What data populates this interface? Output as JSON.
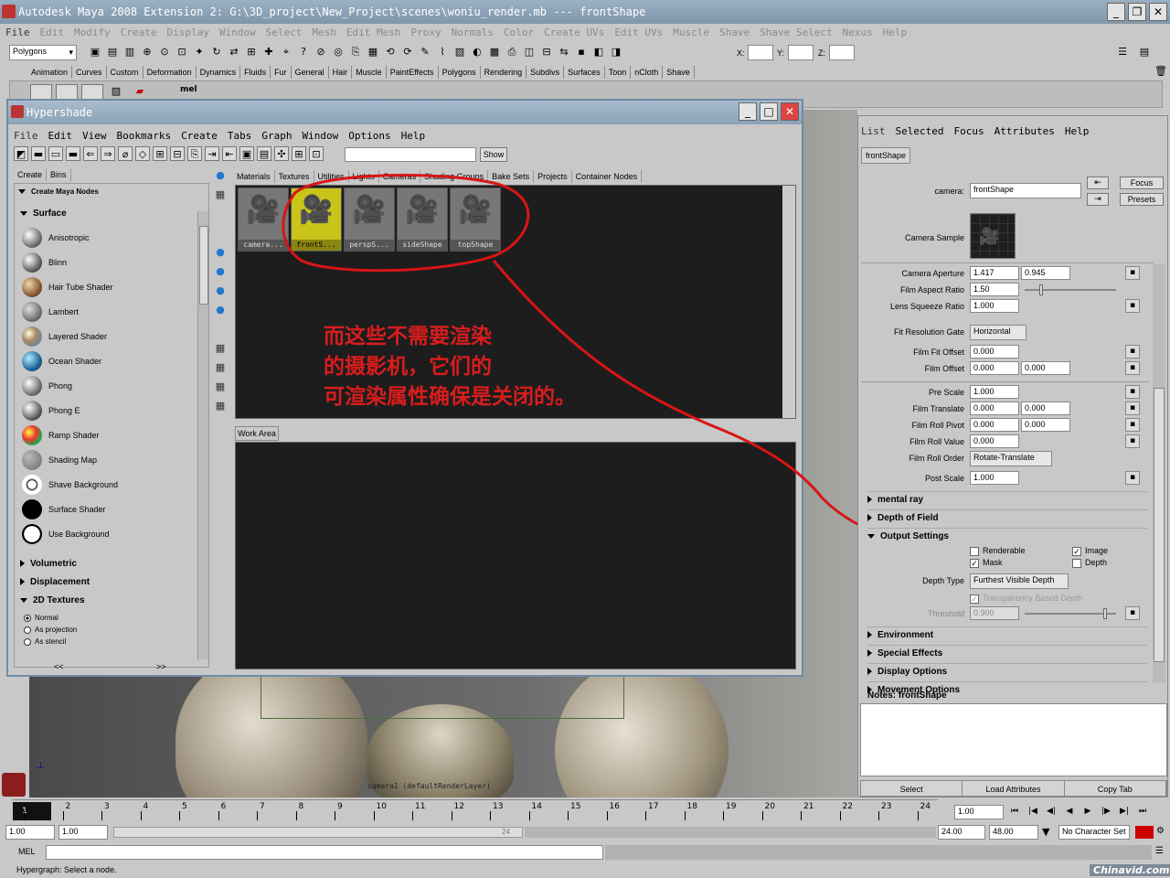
{
  "window": {
    "title": "Autodesk Maya 2008 Extension 2: G:\\3D_project\\New_Project\\scenes\\woniu_render.mb   ---   frontShape"
  },
  "main_menu": [
    "File",
    "Edit",
    "Modify",
    "Create",
    "Display",
    "Window",
    "Select",
    "Mesh",
    "Edit Mesh",
    "Proxy",
    "Normals",
    "Color",
    "Create UVs",
    "Edit UVs",
    "Muscle",
    "Shave",
    "Shave Select",
    "Nexus",
    "Help"
  ],
  "status_line": {
    "mode": "Polygons",
    "x_label": "X:",
    "y_label": "Y:",
    "z_label": "Z:"
  },
  "shelf_tabs": [
    "Animation",
    "Curves",
    "Custom",
    "Deformation",
    "Dynamics",
    "Fluids",
    "Fur",
    "General",
    "Hair",
    "Muscle",
    "PaintEffects",
    "Polygons",
    "Rendering",
    "Subdivs",
    "Surfaces",
    "Toon",
    "nCloth",
    "Shave"
  ],
  "shelf_mel": "mel",
  "hypershade": {
    "title": "Hypershade",
    "menu": [
      "File",
      "Edit",
      "View",
      "Bookmarks",
      "Create",
      "Tabs",
      "Graph",
      "Window",
      "Options",
      "Help"
    ],
    "show_button": "Show",
    "left_tabs": [
      "Create",
      "Bins"
    ],
    "create_header": "Create Maya Nodes",
    "surface_header": "Surface",
    "surface_nodes": [
      "Anisotropic",
      "Blinn",
      "Hair Tube Shader",
      "Lambert",
      "Layered Shader",
      "Ocean Shader",
      "Phong",
      "Phong E",
      "Ramp Shader",
      "Shading Map",
      "Shave Background",
      "Surface Shader",
      "Use Background"
    ],
    "volumetric": "Volumetric",
    "displacement": "Displacement",
    "textures_2d": "2D Textures",
    "tex_options": [
      "Normal",
      "As projection",
      "As stencil"
    ],
    "nav_left": "<<",
    "nav_right": ">>",
    "top_tabs": [
      "Materials",
      "Textures",
      "Utilities",
      "Lights",
      "Cameras",
      "Shading Groups",
      "Bake Sets",
      "Projects",
      "Container Nodes"
    ],
    "cameras": [
      "camera...",
      "frontS...",
      "perspS...",
      "sideShape",
      "topShape"
    ],
    "work_area": "Work Area"
  },
  "annotation": {
    "line1": "而这些不需要渲染",
    "line2": "的摄影机，它们的",
    "line3": "可渲染属性确保是关闭的。"
  },
  "attr_editor": {
    "menu": [
      "List",
      "Selected",
      "Focus",
      "Attributes",
      "Help"
    ],
    "node_tab": "frontShape",
    "camera_label": "camera:",
    "camera_value": "frontShape",
    "focus_btn": "Focus",
    "presets_btn": "Presets",
    "camera_sample": "Camera Sample",
    "rows": [
      {
        "label": "Camera Aperture",
        "v1": "1.417",
        "v2": "0.945"
      },
      {
        "label": "Film Aspect Ratio",
        "v1": "1.50",
        "v2": ""
      },
      {
        "label": "Lens Squeeze Ratio",
        "v1": "1.000",
        "v2": ""
      }
    ],
    "fit_gate_label": "Fit Resolution Gate",
    "fit_gate_value": "Horizontal",
    "rows2": [
      {
        "label": "Film Fit Offset",
        "v1": "0.000",
        "v2": ""
      },
      {
        "label": "Film Offset",
        "v1": "0.000",
        "v2": "0.000"
      }
    ],
    "rows3": [
      {
        "label": "Pre Scale",
        "v1": "1.000",
        "v2": ""
      },
      {
        "label": "Film Translate",
        "v1": "0.000",
        "v2": "0.000"
      },
      {
        "label": "Film Roll Pivot",
        "v1": "0.000",
        "v2": "0.000"
      },
      {
        "label": "Film Roll Value",
        "v1": "0.000",
        "v2": ""
      }
    ],
    "roll_order_label": "Film Roll Order",
    "roll_order_value": "Rotate-Translate",
    "post_scale_label": "Post Scale",
    "post_scale_value": "1.000",
    "sections": [
      "mental ray",
      "Depth of Field"
    ],
    "output_settings": "Output Settings",
    "renderable": "Renderable",
    "image": "Image",
    "mask": "Mask",
    "depth": "Depth",
    "depth_type_label": "Depth Type",
    "depth_type_value": "Furthest Visible Depth",
    "transparency_depth": "Transparency Based Depth",
    "threshold_label": "Threshold",
    "threshold_value": "0.900",
    "sections2": [
      "Environment",
      "Special Effects",
      "Display Options",
      "Movement Options"
    ],
    "notes_label": "Notes:  frontShape",
    "bottom_buttons": [
      "Select",
      "Load Attributes",
      "Copy Tab"
    ]
  },
  "viewport": {
    "camera_label": "camera1 (defaultRenderLayer)"
  },
  "timeline": {
    "ticks": [
      "1",
      "2",
      "3",
      "4",
      "5",
      "6",
      "7",
      "8",
      "9",
      "10",
      "11",
      "12",
      "13",
      "14",
      "15",
      "16",
      "17",
      "18",
      "19",
      "20",
      "21",
      "22",
      "23",
      "24"
    ],
    "current": "1.00"
  },
  "range": {
    "start": "1.00",
    "start2": "1.00",
    "end_label": "24",
    "end": "24.00",
    "end2": "48.00",
    "char_set": "No Character Set"
  },
  "command_line": {
    "label": "MEL"
  },
  "help_line": "Hypergraph: Select a node.",
  "watermark": "Chinavid.com"
}
